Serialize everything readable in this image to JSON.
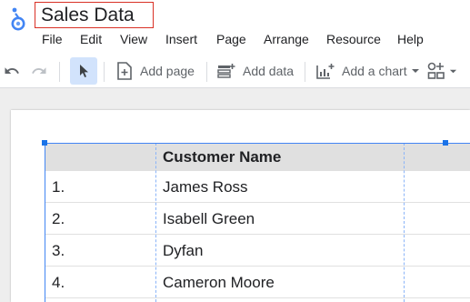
{
  "app": {
    "title": "Sales Data",
    "logo_icon": "looker-studio-logo-icon"
  },
  "menu": [
    "File",
    "Edit",
    "View",
    "Insert",
    "Page",
    "Arrange",
    "Resource",
    "Help"
  ],
  "toolbar": {
    "undo_icon": "undo-icon",
    "redo_icon": "redo-icon",
    "select_icon": "pointer-icon",
    "add_page_label": "Add page",
    "add_data_label": "Add data",
    "add_chart_label": "Add a chart",
    "controls_icon": "add-control-icon"
  },
  "table": {
    "header": "Customer Name",
    "rows": [
      {
        "index": "1.",
        "name": "James Ross"
      },
      {
        "index": "2.",
        "name": "Isabell Green"
      },
      {
        "index": "3.",
        "name": "Dyfan"
      },
      {
        "index": "4.",
        "name": "Cameron Moore"
      }
    ]
  },
  "colors": {
    "accent": "#1a73e8",
    "title_border": "#d93025",
    "selected_tool_bg": "#d2e3fc",
    "header_bg": "#e0e0e0"
  }
}
